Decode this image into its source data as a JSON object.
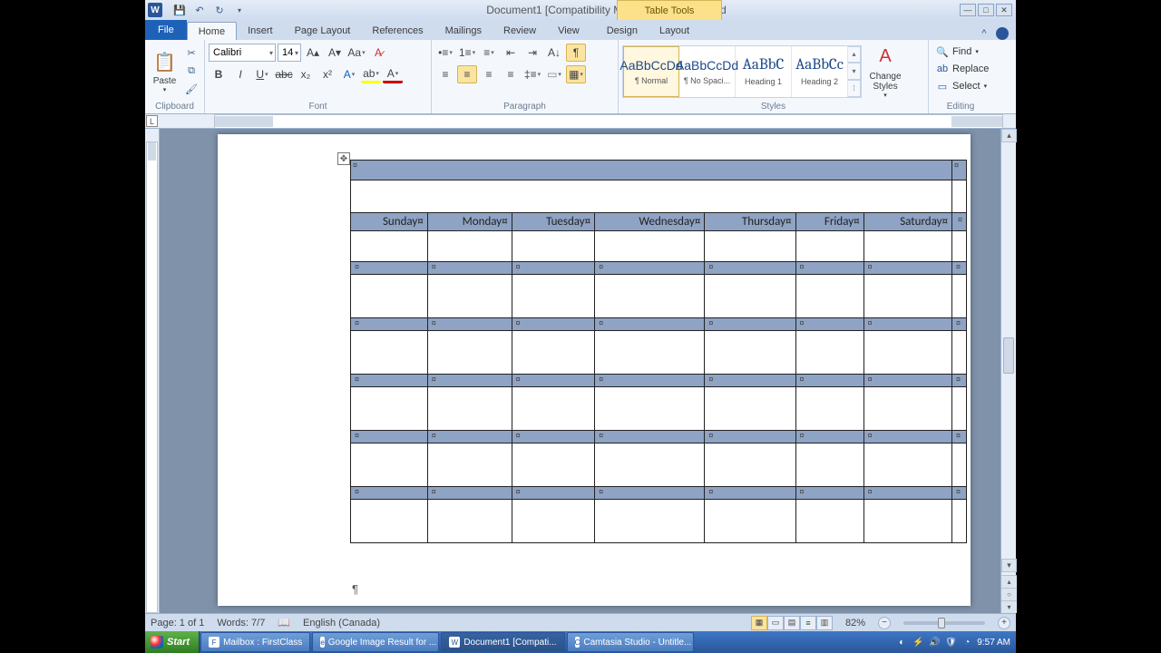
{
  "title": "Document1 [Compatibility Mode] - Microsoft Word",
  "table_tools_label": "Table Tools",
  "tabs": {
    "file": "File",
    "home": "Home",
    "insert": "Insert",
    "page_layout": "Page Layout",
    "references": "References",
    "mailings": "Mailings",
    "review": "Review",
    "view": "View",
    "design": "Design",
    "layout": "Layout"
  },
  "groups": {
    "clipboard": "Clipboard",
    "font": "Font",
    "paragraph": "Paragraph",
    "styles": "Styles",
    "editing": "Editing"
  },
  "clipboard": {
    "paste": "Paste"
  },
  "font": {
    "name": "Calibri",
    "size": "14"
  },
  "styles": {
    "items": [
      {
        "preview": "AaBbCcDd",
        "label": "¶ Normal"
      },
      {
        "preview": "AaBbCcDd",
        "label": "¶ No Spaci..."
      },
      {
        "preview": "AaBbC",
        "label": "Heading 1"
      },
      {
        "preview": "AaBbCc",
        "label": "Heading 2"
      }
    ],
    "change": "Change Styles"
  },
  "editing": {
    "find": "Find",
    "replace": "Replace",
    "select": "Select"
  },
  "calendar": {
    "days": [
      "Sunday¤",
      "Monday¤",
      "Tuesday¤",
      "Wednesday¤",
      "Thursday¤",
      "Friday¤",
      "Saturday¤"
    ]
  },
  "status": {
    "page": "Page: 1 of 1",
    "words": "Words: 7/7",
    "language": "English (Canada)",
    "zoom": "82%"
  },
  "taskbar": {
    "start": "Start",
    "items": [
      "Mailbox : FirstClass",
      "Google Image Result for ...",
      "Document1 [Compati...",
      "Camtasia Studio - Untitle..."
    ],
    "time": "9:57 AM"
  }
}
